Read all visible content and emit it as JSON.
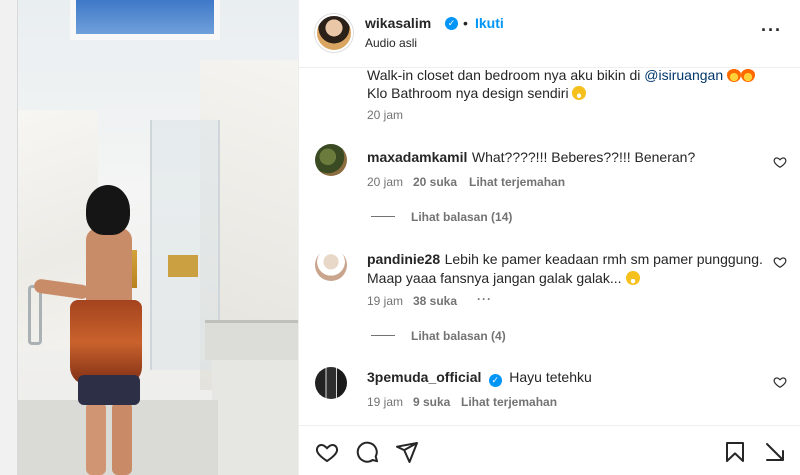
{
  "post": {
    "username": "wikasalim",
    "dot": "•",
    "follow_label": "Ikuti",
    "subtitle": "Audio asli",
    "more_label": "···"
  },
  "caption": {
    "line1_text": "Walk-in closet dan bedroom nya aku bikin di ",
    "line1_mention": "@isiruangan",
    "line2_text": "Klo Bathroom nya design sendiri",
    "time": "20 jam"
  },
  "comments": [
    {
      "username": "maxadamkamil",
      "text": "What????!!! Beberes??!!! Beneran?",
      "time": "20 jam",
      "likes": "20 suka",
      "translate": "Lihat terjemahan",
      "replies": "Lihat balasan (14)"
    },
    {
      "username": "pandinie28",
      "text": "Lebih ke pamer keadaan rmh sm pamer punggung. Maap yaaa fansnya jangan galak galak...",
      "time": "19 jam",
      "likes": "38 suka",
      "more": "···",
      "replies": "Lihat balasan (4)"
    },
    {
      "username": "3pemuda_official",
      "text": "Hayu tetehku",
      "time": "19 jam",
      "likes": "9 suka",
      "translate": "Lihat terjemahan"
    }
  ],
  "colors": {
    "accent": "#0095f6",
    "text": "#262626",
    "muted": "#737373",
    "mention": "#00376b"
  },
  "icons": [
    "heart-icon",
    "comment-icon",
    "share-icon",
    "bookmark-icon",
    "more-icon",
    "verified-icon"
  ]
}
